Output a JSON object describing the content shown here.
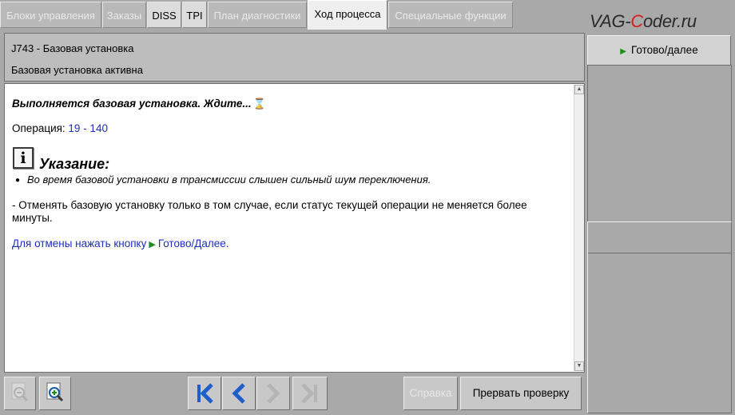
{
  "tabs": [
    {
      "label": "Блоки управления",
      "state": "disabled"
    },
    {
      "label": "Заказы",
      "state": "disabled"
    },
    {
      "label": "DISS",
      "state": "enabled"
    },
    {
      "label": "TPI",
      "state": "enabled"
    },
    {
      "label": "План диагностики",
      "state": "disabled"
    },
    {
      "label": "Ход процесса",
      "state": "active"
    },
    {
      "label": "Специальные функции",
      "state": "disabled"
    }
  ],
  "watermark": {
    "before": "VAG-",
    "accent": "C",
    "after": "oder.ru"
  },
  "header": {
    "title": "J743 - Базовая установка",
    "subtitle": "Базовая установка активна"
  },
  "content": {
    "progress_message": "Выполняется базовая установка. Ждите...",
    "hourglass_glyph": "⌛",
    "operation_label": "Операция: ",
    "operation_value": "19 - 140",
    "note_title": "Указание:",
    "note_bullet": "Во время базовой установки в трансмиссии слышен сильный шум переключения.",
    "paragraph": "- Отменять базовую установку только в том случае, если статус текущей операции не меняется более минуты.",
    "cancel_hint_prefix": "Для отмены нажать кнопку",
    "cancel_hint_button": "Готово/Далее."
  },
  "toolbar": {
    "zoom_out_icon": "zoom-out-icon",
    "zoom_in_icon": "zoom-in-icon",
    "first_icon": "first-page-icon",
    "prev_icon": "previous-page-icon",
    "next_icon": "next-page-icon",
    "last_icon": "last-page-icon",
    "help_label": "Справка",
    "abort_label": "Прервать проверку"
  },
  "right_panel": {
    "next_button_label": "Готово/далее"
  },
  "colors": {
    "accent_blue": "#1f2fbf",
    "accent_green": "#1f8c1f",
    "logo_red": "#d81f1f"
  }
}
